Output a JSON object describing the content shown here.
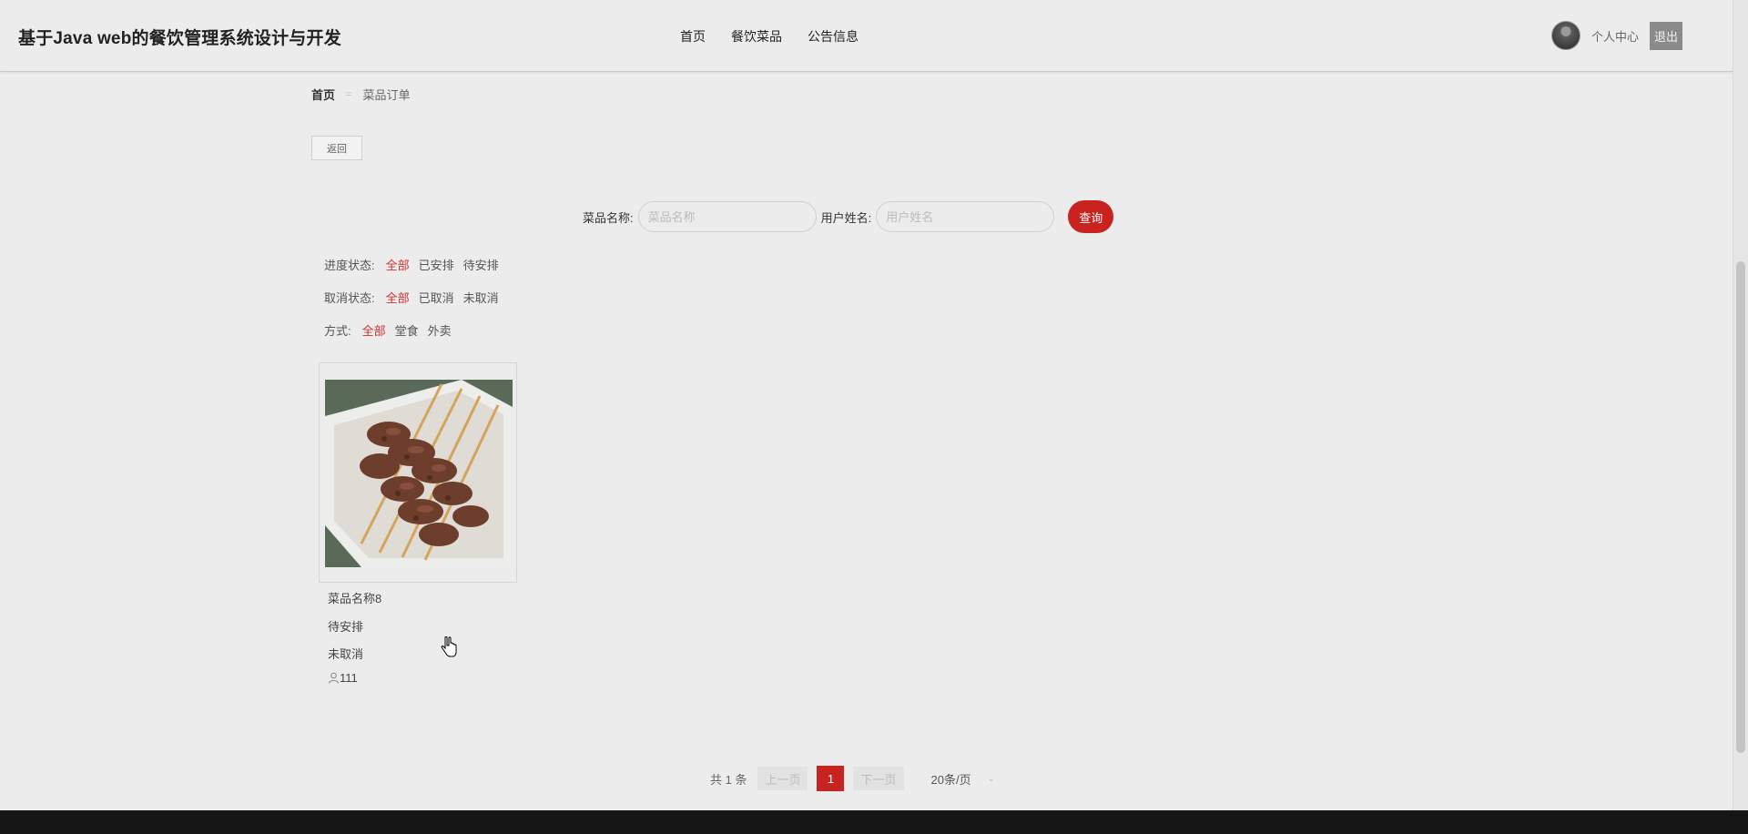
{
  "header": {
    "site_title": "基于Java web的餐饮管理系统设计与开发",
    "nav": [
      "首页",
      "餐饮菜品",
      "公告信息"
    ],
    "profile_label": "个人中心",
    "logout_label": "退出"
  },
  "breadcrumb": {
    "home": "首页",
    "separator": "=",
    "current": "菜品订单"
  },
  "back_label": "返回",
  "search": {
    "dish_label": "菜品名称:",
    "dish_placeholder": "菜品名称",
    "user_label": "用户姓名:",
    "user_placeholder": "用户姓名",
    "query_label": "查询"
  },
  "filters": [
    {
      "label": "进度状态:",
      "options": [
        "全部",
        "已安排",
        "待安排"
      ],
      "active": 0
    },
    {
      "label": "取消状态:",
      "options": [
        "全部",
        "已取消",
        "未取消"
      ],
      "active": 0
    },
    {
      "label": "方式:",
      "options": [
        "全部",
        "堂食",
        "外卖"
      ],
      "active": 0
    }
  ],
  "orders": [
    {
      "name": "菜品名称8",
      "progress": "待安排",
      "cancel": "未取消",
      "user_count": "111",
      "image": "grilled-skewers"
    }
  ],
  "pagination": {
    "total": "共 1 条",
    "prev": "上一页",
    "current": "1",
    "next": "下一页",
    "page_size": "20条/页"
  },
  "colors": {
    "accent": "#c8231f",
    "active_filter": "#d03030",
    "footer": "#161616"
  }
}
